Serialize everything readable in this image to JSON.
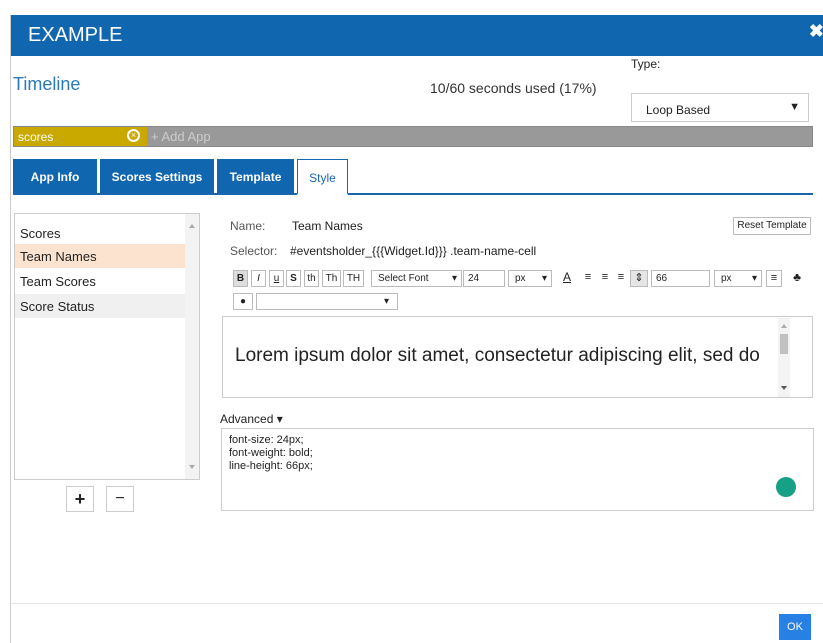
{
  "dialog": {
    "title": "EXAMPLE",
    "close": "✖"
  },
  "timeline": {
    "title": "Timeline",
    "seconds_used": "10/60 seconds used (17%)"
  },
  "type": {
    "label": "Type:",
    "value": "Loop Based"
  },
  "apps": {
    "chip_label": "scores",
    "add_app": "+ Add App"
  },
  "tabs": [
    {
      "label": "App Info",
      "active": false
    },
    {
      "label": "Scores Settings",
      "active": false
    },
    {
      "label": "Template",
      "active": false
    },
    {
      "label": "Style",
      "active": true
    }
  ],
  "list": {
    "items": [
      {
        "label": "Scores",
        "selected": false
      },
      {
        "label": "Team Names",
        "selected": true
      },
      {
        "label": "Team Scores",
        "selected": false
      },
      {
        "label": "Score Status",
        "selected": false
      }
    ],
    "add": "+",
    "remove": "−"
  },
  "style": {
    "name_label": "Name:",
    "name_value": "Team Names",
    "selector_label": "Selector:",
    "selector_value": "#eventsholder_{{{Widget.Id}}} .team-name-cell",
    "reset_label": "Reset Template",
    "font_select": "Select Font",
    "font_size": "24",
    "font_unit": "px",
    "line_height": "66",
    "line_unit": "px",
    "buttons": {
      "bold": "B",
      "italic": "I",
      "underline": "u",
      "strike": "S",
      "th1": "th",
      "th2": "Th",
      "th3": "TH"
    },
    "preview_text": "Lorem ipsum dolor sit amet, consectetur adipiscing elit, sed do",
    "advanced_label": "Advanced",
    "css_lines": [
      "font-size: 24px;",
      "font-weight: bold;",
      "line-height: 66px;"
    ]
  },
  "footer": {
    "ok": "OK"
  },
  "colors": {
    "header": "#1166b0",
    "chip": "#c9a800",
    "selected_item": "#fbe3cf",
    "accent": "#2a7ab8"
  }
}
